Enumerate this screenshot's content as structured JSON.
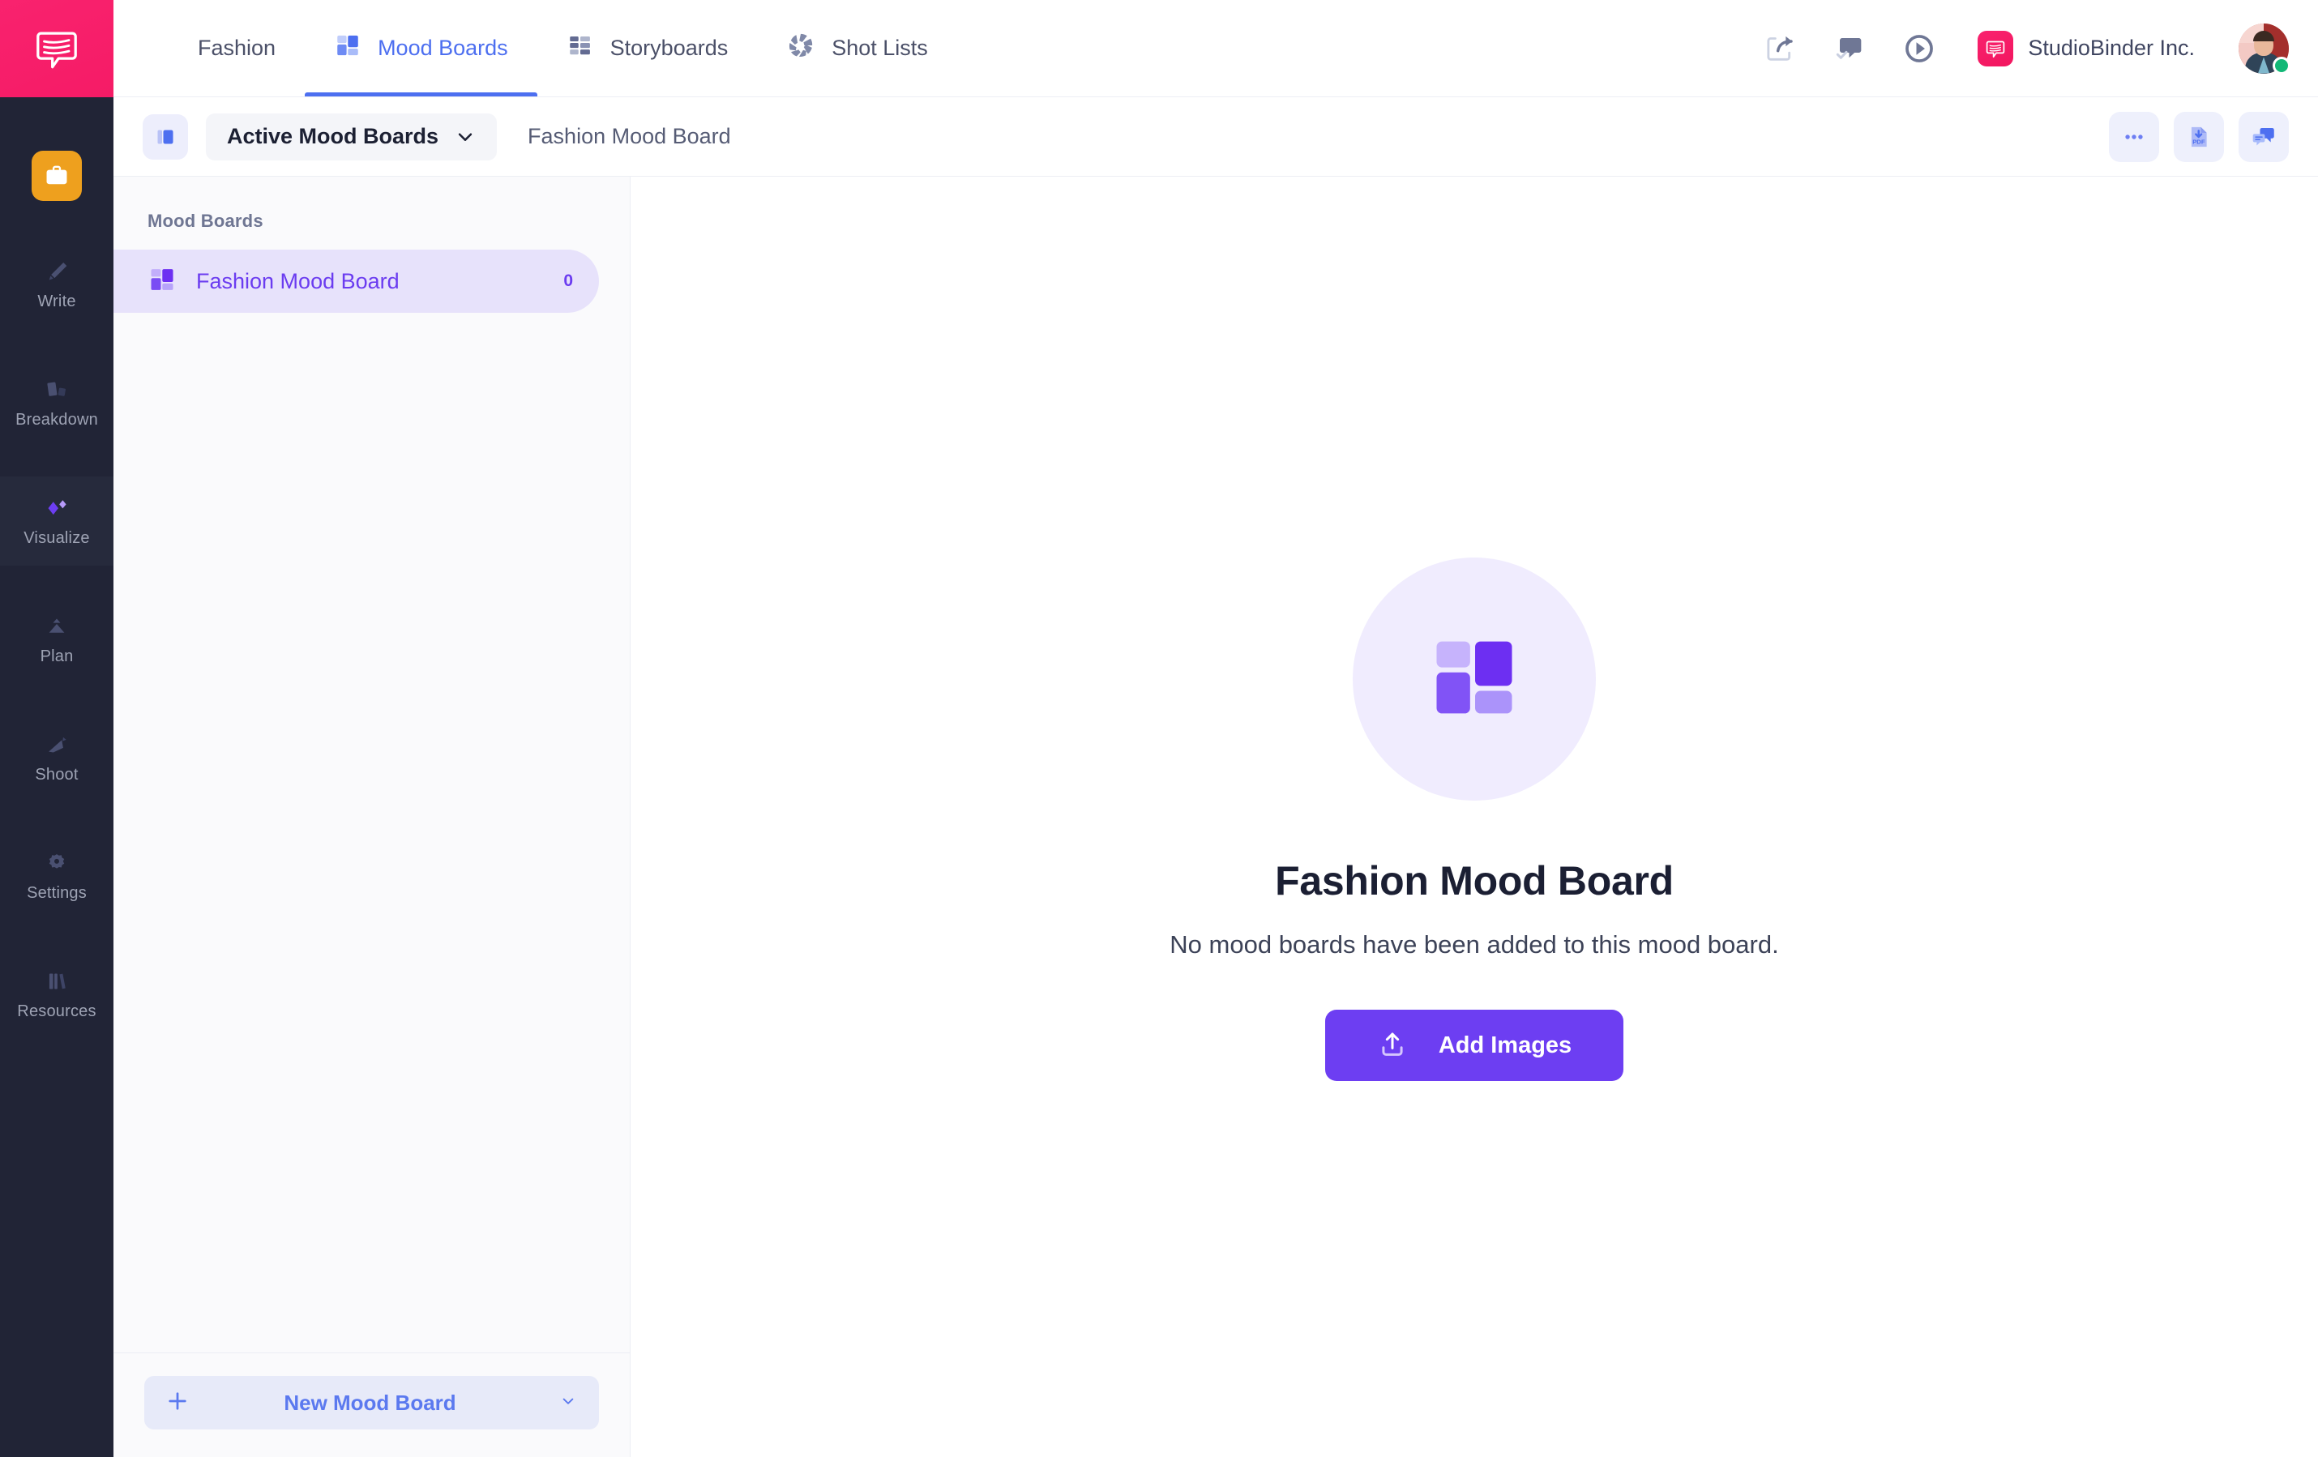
{
  "brand": {
    "logo_icon": "studiobinder-chat-logo-icon",
    "project_icon": "briefcase-icon",
    "pink": "#f9226e",
    "rail_bg": "#212436",
    "accent_blue": "#4d6ff0",
    "accent_purple": "#6d3ef2"
  },
  "rail": {
    "items": [
      {
        "label": "Write",
        "icon": "pen-icon",
        "active": false
      },
      {
        "label": "Breakdown",
        "icon": "breakdown-cards-icon",
        "active": false
      },
      {
        "label": "Visualize",
        "icon": "diamonds-icon",
        "active": true
      },
      {
        "label": "Plan",
        "icon": "mountain-icon",
        "active": false
      },
      {
        "label": "Shoot",
        "icon": "clapper-arrow-icon",
        "active": false
      },
      {
        "label": "Settings",
        "icon": "gear-icon",
        "active": false
      },
      {
        "label": "Resources",
        "icon": "books-icon",
        "active": false
      }
    ]
  },
  "topnav": {
    "tabs": [
      {
        "label": "Fashion",
        "icon": null,
        "active": false
      },
      {
        "label": "Mood Boards",
        "icon": "mood-board-icon",
        "active": true
      },
      {
        "label": "Storyboards",
        "icon": "storyboard-grid-icon",
        "active": false
      },
      {
        "label": "Shot Lists",
        "icon": "aperture-icon",
        "active": false
      }
    ],
    "actions": [
      {
        "name": "share-icon"
      },
      {
        "name": "message-check-icon"
      },
      {
        "name": "play-circle-icon"
      }
    ],
    "org_name": "StudioBinder Inc.",
    "org_badge_icon": "studiobinder-chat-logo-icon",
    "avatar": "user-avatar",
    "presence": "online"
  },
  "toolbar": {
    "view_icon": "panel-layout-icon",
    "filter_label": "Active Mood Boards",
    "filter_caret": "chevron-down-icon",
    "breadcrumb": "Fashion Mood Board",
    "buttons": [
      {
        "name": "more-options-icon",
        "glyph": "…"
      },
      {
        "name": "download-pdf-icon",
        "glyph": "PDF"
      },
      {
        "name": "comments-icon",
        "glyph": ""
      }
    ]
  },
  "listpanel": {
    "header": "Mood Boards",
    "boards": [
      {
        "name": "Fashion Mood Board",
        "count": "0",
        "icon": "mood-board-icon",
        "selected": true
      }
    ],
    "new_button": {
      "plus_icon": "plus-icon",
      "label": "New Mood Board",
      "caret_icon": "chevron-down-icon"
    }
  },
  "main": {
    "empty_icon": "mood-board-icon",
    "title": "Fashion Mood Board",
    "subtitle": "No mood boards have been added to this mood board.",
    "add_button": {
      "label": "Add Images",
      "icon": "upload-icon"
    }
  }
}
